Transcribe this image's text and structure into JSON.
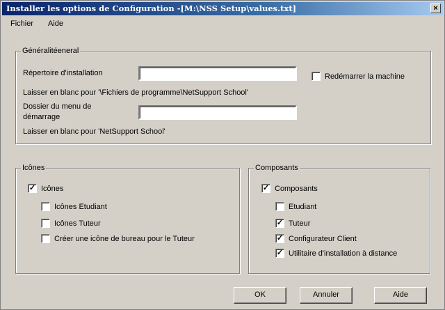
{
  "window": {
    "title": "Installer les options de Configuration -[M:\\NSS Setup\\values.txt]",
    "close_glyph": "×"
  },
  "menu": {
    "file": "Fichier",
    "help": "Aide"
  },
  "general": {
    "legend": "Généralitéeneral",
    "install_dir_label": "Répertoire d'installation",
    "install_dir_value": "",
    "install_dir_hint": "Laisser en blanc pour '\\Fichiers de programme\\NetSupport School'",
    "start_menu_label_line1": "Dossier du menu de",
    "start_menu_label_line2": "démarrage",
    "start_menu_value": "",
    "start_menu_hint": "Laisser en blanc pour 'NetSupport School'",
    "restart_label": "Redémarrer la machine",
    "restart_checked": false
  },
  "icons": {
    "legend": "Icônes",
    "items": [
      {
        "label": "Icônes",
        "checked": true
      },
      {
        "label": "Icônes Etudiant",
        "checked": false
      },
      {
        "label": "Icônes Tuteur",
        "checked": false
      },
      {
        "label": "Créer une icône de bureau pour le Tuteur",
        "checked": false
      }
    ]
  },
  "components": {
    "legend": "Composants",
    "items": [
      {
        "label": "Composants",
        "checked": true
      },
      {
        "label": "Etudiant",
        "checked": false
      },
      {
        "label": "Tuteur",
        "checked": true
      },
      {
        "label": "Configurateur Client",
        "checked": true
      },
      {
        "label": "Utilitaire d'installation à distance",
        "checked": true
      }
    ]
  },
  "buttons": {
    "ok": "OK",
    "cancel": "Annuler",
    "help": "Aide"
  },
  "check_glyph": "✓"
}
